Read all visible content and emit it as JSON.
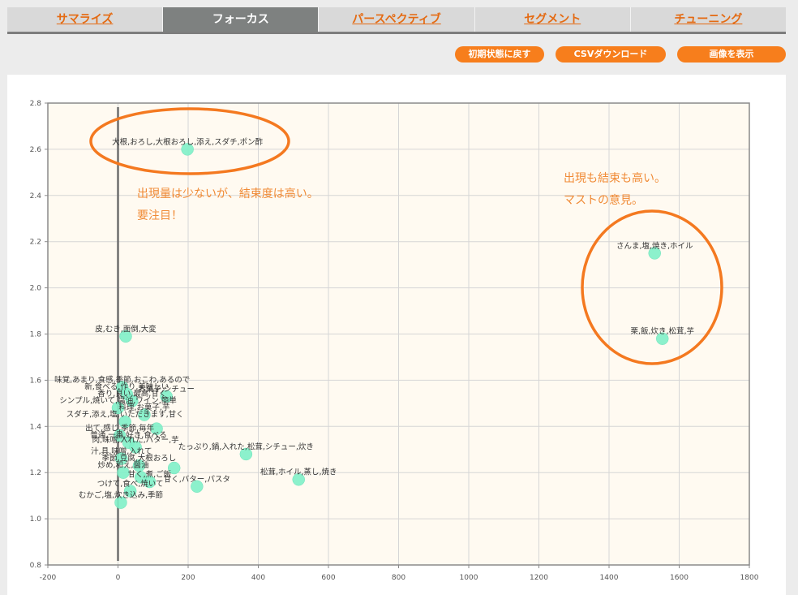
{
  "tabs": [
    {
      "label": "サマライズ",
      "active": false
    },
    {
      "label": "フォーカス",
      "active": true
    },
    {
      "label": "パースペクティブ",
      "active": false
    },
    {
      "label": "セグメント",
      "active": false
    },
    {
      "label": "チューニング",
      "active": false
    }
  ],
  "toolbar": {
    "reset_label": "初期状態に戻す",
    "csv_label": "CSVダウンロード",
    "image_label": "画像を表示"
  },
  "annotations": {
    "left_line1": "出現量は少ないが、結束度は高い。",
    "left_line2": "要注目！",
    "right_line1": "出現も結束も高い。",
    "right_line2": "マストの意見。"
  },
  "colors": {
    "accent": "#f77e1c",
    "point": "#7ff0c8",
    "plot_bg": "#fffaf1",
    "ellipse": "#f47920"
  },
  "chart_data": {
    "type": "scatter",
    "xlim": [
      -200,
      1800
    ],
    "ylim": [
      0.8,
      2.8
    ],
    "xticks": [
      -200,
      0,
      200,
      400,
      600,
      800,
      1000,
      1200,
      1400,
      1600,
      1800
    ],
    "yticks": [
      0.8,
      1.0,
      1.2,
      1.4,
      1.6,
      1.8,
      2.0,
      2.2,
      2.4,
      2.6,
      2.8
    ],
    "xtick_labels": [
      "-200",
      "0",
      "200",
      "400",
      "600",
      "800",
      "1000",
      "1200",
      "1400",
      "1600",
      "1800"
    ],
    "ytick_labels": [
      "0.8",
      "1.0",
      "1.2",
      "1.4",
      "1.6",
      "1.8",
      "2.0",
      "2.2",
      "2.4",
      "2.6",
      "2.8"
    ],
    "grid": true,
    "points": [
      {
        "x": 198,
        "y": 2.6,
        "label": "大根,おろし,大根おろし,添え,スダチ,ポン酢"
      },
      {
        "x": 1530,
        "y": 2.15,
        "label": "さんま,塩,焼き,ホイル"
      },
      {
        "x": 1552,
        "y": 1.78,
        "label": "栗,飯,炊き,松茸,芋"
      },
      {
        "x": 22,
        "y": 1.79,
        "label": "皮,むき,面倒,大変"
      },
      {
        "x": 138,
        "y": 1.53,
        "label": "お菓子,シチュー"
      },
      {
        "x": 365,
        "y": 1.28,
        "label": "たっぷり,鍋,入れた,松茸,シチュー,炊き"
      },
      {
        "x": 515,
        "y": 1.17,
        "label": "松茸,ホイル,蒸し,焼き"
      },
      {
        "x": 225,
        "y": 1.14,
        "label": "甘く,バター,パスタ"
      },
      {
        "x": 8,
        "y": 1.07,
        "label": "むかご,塩,炊き込み,季節"
      },
      {
        "x": 12,
        "y": 1.57,
        "label": "味覚,あまり,食感,季節,おこわ,あるので"
      },
      {
        "x": 25,
        "y": 1.54,
        "label": "新,食べる,作り,美味しい"
      },
      {
        "x": 40,
        "y": 1.51,
        "label": "香り,良い,最高,甘く"
      },
      {
        "x": 0,
        "y": 1.48,
        "label": "シンプル,焼いて,醤油,ワイン,簡単"
      },
      {
        "x": 75,
        "y": 1.45,
        "label": "料理,お菓子,芋"
      },
      {
        "x": 20,
        "y": 1.42,
        "label": "スダチ,添え,塩,いただきます,甘く"
      },
      {
        "x": 5,
        "y": 1.36,
        "label": "出て,感じ,季節,毎年"
      },
      {
        "x": 30,
        "y": 1.33,
        "label": "普通,一番,好き,食べる"
      },
      {
        "x": 50,
        "y": 1.31,
        "label": "肉,味噌,入れた,バター,芋"
      },
      {
        "x": 10,
        "y": 1.26,
        "label": "汁,具,味噌,入れて"
      },
      {
        "x": 60,
        "y": 1.23,
        "label": "季節,豆腐,大根おろし"
      },
      {
        "x": 15,
        "y": 1.2,
        "label": "炒め,和え,醤油"
      },
      {
        "x": 90,
        "y": 1.16,
        "label": "甘く,煮,ご飯"
      },
      {
        "x": 35,
        "y": 1.12,
        "label": "つけて,食べ,焼いて"
      },
      {
        "x": 110,
        "y": 1.39,
        "label": ""
      },
      {
        "x": 160,
        "y": 1.22,
        "label": ""
      },
      {
        "x": 65,
        "y": 1.18,
        "label": ""
      }
    ]
  }
}
